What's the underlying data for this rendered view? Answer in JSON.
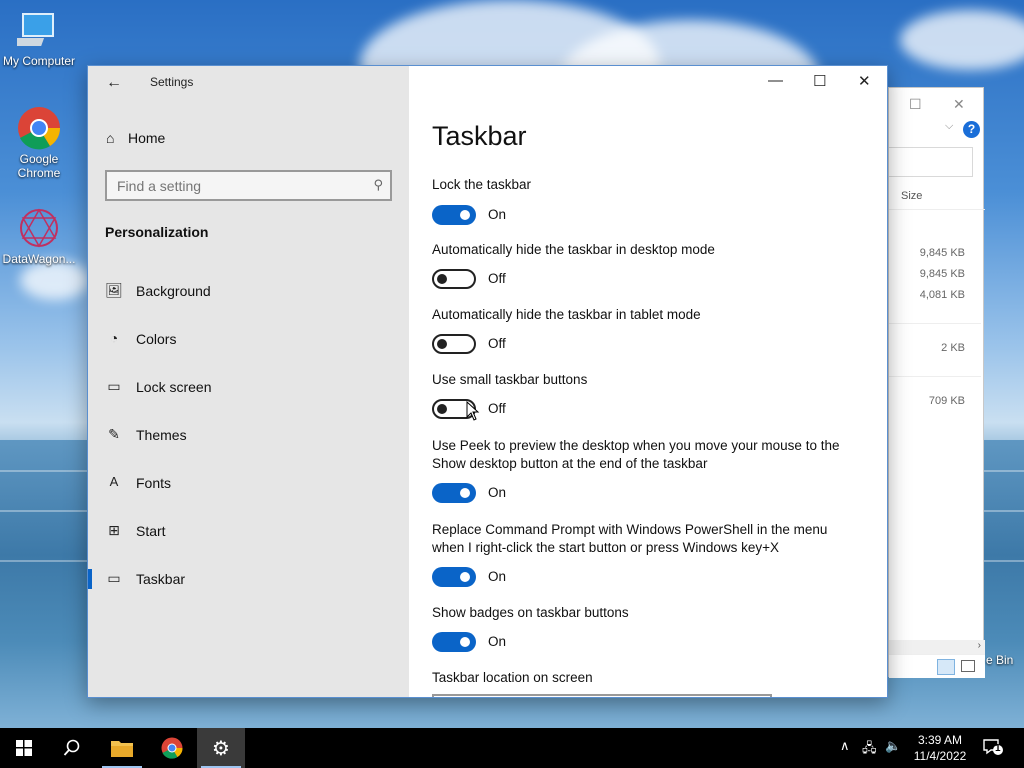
{
  "desktop": {
    "icons": [
      {
        "label": "My Computer"
      },
      {
        "label": "Google Chrome"
      },
      {
        "label": "DataWagon..."
      }
    ]
  },
  "explorer": {
    "column_size": "Size",
    "sizes": [
      "9,845 KB",
      "9,845 KB",
      "4,081 KB",
      "2 KB",
      "709 KB"
    ],
    "help": "?",
    "recycle_partial": "e Bin"
  },
  "settings": {
    "window_title": "Settings",
    "back_icon": "back-arrow-icon",
    "home_label": "Home",
    "search_placeholder": "Find a setting",
    "section": "Personalization",
    "nav": [
      {
        "label": "Background",
        "icon": "picture-icon"
      },
      {
        "label": "Colors",
        "icon": "palette-icon"
      },
      {
        "label": "Lock screen",
        "icon": "lock-screen-icon"
      },
      {
        "label": "Themes",
        "icon": "themes-icon"
      },
      {
        "label": "Fonts",
        "icon": "fonts-icon"
      },
      {
        "label": "Start",
        "icon": "start-icon"
      },
      {
        "label": "Taskbar",
        "icon": "taskbar-icon",
        "selected": true
      }
    ],
    "page_title": "Taskbar",
    "options": [
      {
        "label": "Lock the taskbar",
        "state": "On",
        "on": true
      },
      {
        "label": "Automatically hide the taskbar in desktop mode",
        "state": "Off",
        "on": false
      },
      {
        "label": "Automatically hide the taskbar in tablet mode",
        "state": "Off",
        "on": false
      },
      {
        "label": "Use small taskbar buttons",
        "state": "Off",
        "on": false
      },
      {
        "label_line1": "Use Peek to preview the desktop when you move your mouse to the",
        "label_line2": "Show desktop button at the end of the taskbar",
        "state": "On",
        "on": true
      },
      {
        "label_line1": "Replace Command Prompt with Windows PowerShell in the menu",
        "label_line2": "when I right-click the start button or press Windows key+X",
        "state": "On",
        "on": true
      },
      {
        "label": "Show badges on taskbar buttons",
        "state": "On",
        "on": true
      }
    ],
    "location_label": "Taskbar location on screen"
  },
  "taskbar": {
    "time": "3:39 AM",
    "date": "11/4/2022",
    "notification_count": "1"
  },
  "colors": {
    "accent": "#0a64c8",
    "sidebar_bg": "#e6e6e6",
    "taskbar_bg": "#000000"
  }
}
